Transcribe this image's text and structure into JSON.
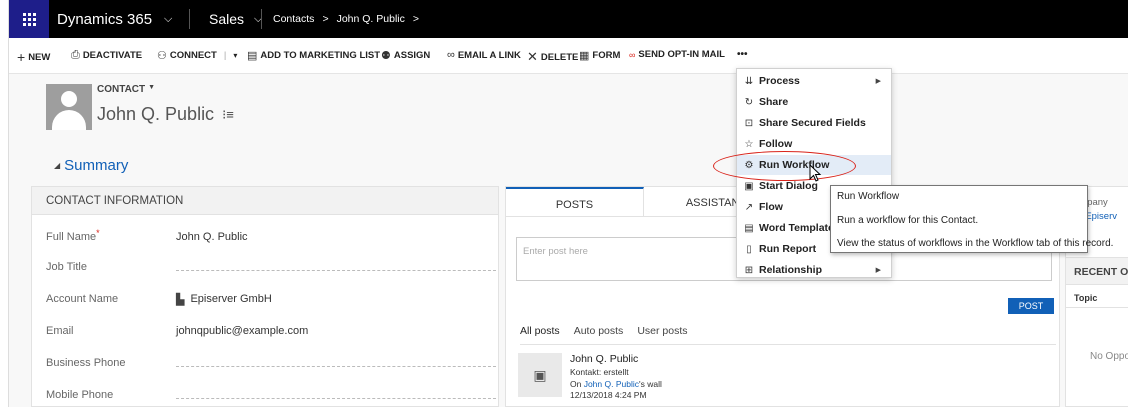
{
  "topbar": {
    "app_name": "Dynamics 365",
    "app_chevron": "⌵",
    "module": "Sales",
    "module_chevron": "⌵",
    "breadcrumb_1": "Contacts",
    "breadcrumb_sep": ">",
    "breadcrumb_2": "John Q. Public",
    "breadcrumb_end": ">"
  },
  "commands": {
    "new": "NEW",
    "deactivate": "DEACTIVATE",
    "connect": "CONNECT",
    "add_to_marketing_list": "ADD TO MARKETING LIST",
    "assign": "ASSIGN",
    "email_a_link": "EMAIL A LINK",
    "delete": "DELETE",
    "form": "FORM",
    "send_opt_in_mail": "SEND OPT-IN MAIL",
    "more": "•••"
  },
  "record": {
    "entity_label": "CONTACT",
    "name": "John Q. Public"
  },
  "summary": {
    "title": "Summary"
  },
  "contact_info": {
    "header": "CONTACT INFORMATION",
    "full_name_label": "Full Name",
    "full_name_value": "John Q. Public",
    "job_title_label": "Job Title",
    "account_name_label": "Account Name",
    "account_name_value": "Episerver GmbH",
    "email_label": "Email",
    "email_value": "johnqpublic@example.com",
    "business_phone_label": "Business Phone",
    "mobile_phone_label": "Mobile Phone"
  },
  "posts": {
    "tab_posts": "POSTS",
    "tab_assistant": "ASSISTANT",
    "placeholder": "Enter post here",
    "post_button": "POST",
    "filter_all": "All posts",
    "filter_auto": "Auto posts",
    "filter_user": "User posts",
    "item_author": "John Q. Public",
    "item_line1": "Kontakt: erstellt",
    "item_on": "On ",
    "item_wall_link": "John Q. Public",
    "item_wall_suffix": "'s wall",
    "item_time": "12/13/2018 4:24 PM"
  },
  "right_panel": {
    "company_label": "ompany",
    "company_link": "Episerv",
    "recent_header": "RECENT OF",
    "topic_label": "Topic",
    "no_items": "No Oppo"
  },
  "more_menu": {
    "items": [
      {
        "label": "Process",
        "icon": "process-icon",
        "submenu": true
      },
      {
        "label": "Share",
        "icon": "share-icon",
        "submenu": false
      },
      {
        "label": "Share Secured Fields",
        "icon": "shield-icon",
        "submenu": false
      },
      {
        "label": "Follow",
        "icon": "star-icon",
        "submenu": false
      },
      {
        "label": "Run Workflow",
        "icon": "gear-icon",
        "submenu": false
      },
      {
        "label": "Start Dialog",
        "icon": "dialog-icon",
        "submenu": false
      },
      {
        "label": "Flow",
        "icon": "flow-icon",
        "submenu": false
      },
      {
        "label": "Word Templates",
        "icon": "word-icon",
        "submenu": false
      },
      {
        "label": "Run Report",
        "icon": "report-icon",
        "submenu": false
      },
      {
        "label": "Relationship",
        "icon": "relationship-icon",
        "submenu": true
      }
    ]
  },
  "tooltip": {
    "title": "Run Workflow",
    "line1": "Run a workflow for this Contact.",
    "line2": "View the status of workflows in the Workflow tab of this record."
  },
  "colors": {
    "brand": "#1e1e8a",
    "link": "#1160b7",
    "highlight_circle": "#d9241b",
    "post_button": "#1160b7"
  }
}
